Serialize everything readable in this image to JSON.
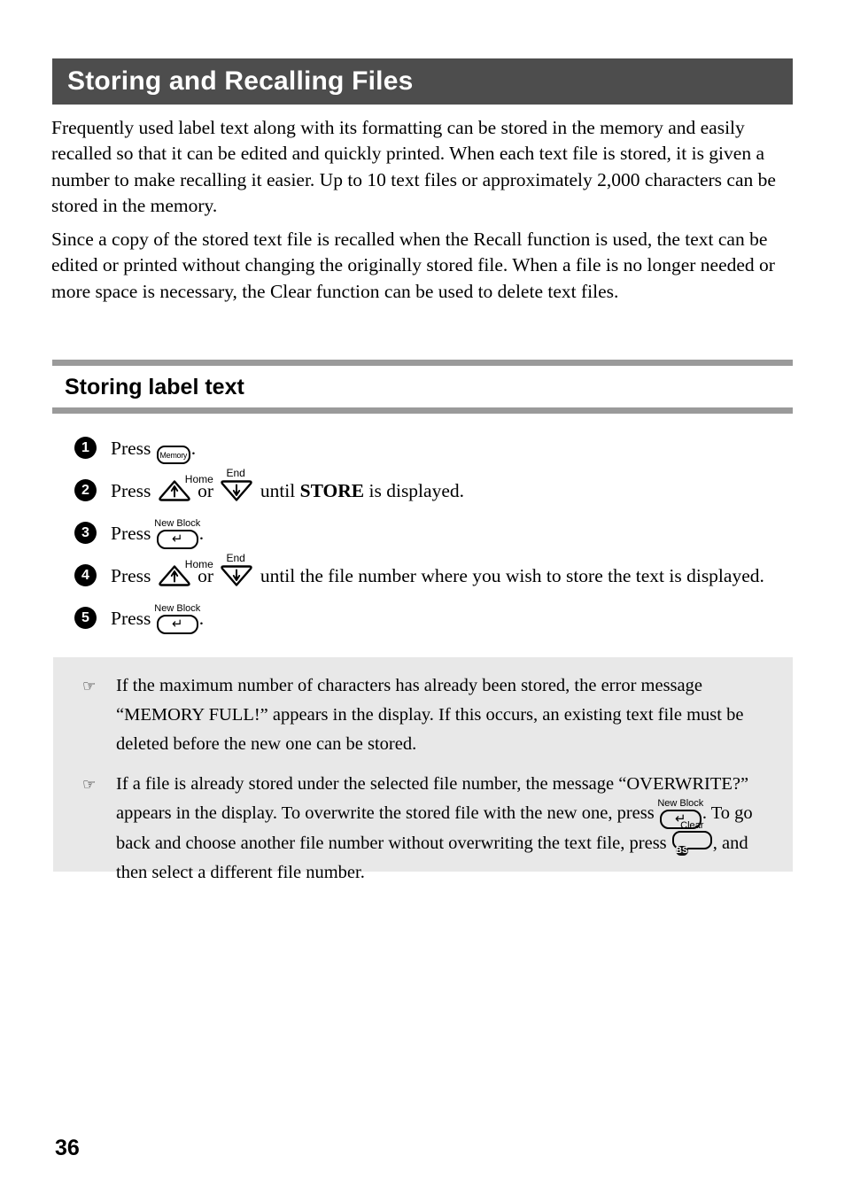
{
  "document": {
    "chapter_title": "Storing and Recalling Files",
    "page_number": "36",
    "colors": {
      "header_bar": "#4d4d4d",
      "rule": "#9a9a9a",
      "note_background": "#e8e8e8",
      "text": "#000000"
    }
  },
  "intro": {
    "paragraph_1": "Frequently used label text along with its formatting can be stored in the memory and easily recalled so that it can be edited and quickly printed. When each text file is stored, it is given a number to make recalling it easier. Up to 10 text files or approximately 2,000 characters can be stored in the memory.",
    "paragraph_2": "Since a copy of the stored text file is recalled when the Recall function is used, the text can be edited or printed without changing the originally stored file. When a file is no longer needed or more space is necessary, the Clear function can be used to delete text files."
  },
  "section": {
    "title": "Storing label text"
  },
  "steps": [
    {
      "number": "1",
      "text_before": "Press",
      "text_after": "."
    },
    {
      "number": "2",
      "text_before": "Press",
      "text_middle": "or",
      "text_after_bold": "STORE",
      "text_tail_before_bold": "until",
      "text_tail_after_bold": "is displayed."
    },
    {
      "number": "3",
      "text_before": "Press",
      "text_after": "."
    },
    {
      "number": "4",
      "text_before": "Press",
      "text_middle": "or",
      "text_after": "until the file number where you wish to store the text is displayed."
    },
    {
      "number": "5",
      "text_before": "Press",
      "text_after": "."
    }
  ],
  "keys": {
    "memory": {
      "label": "Memory",
      "cap": ""
    },
    "new_block": {
      "label": "↵",
      "cap": "New Block"
    },
    "up_arrow": {
      "label": "↑",
      "cap": "Home"
    },
    "down_arrow": {
      "label": "↓",
      "cap": "End"
    },
    "backspace": {
      "label": "BS",
      "cap": "Clear"
    }
  },
  "notes": {
    "bullet_glyph": "☞",
    "items": [
      {
        "text": "If the maximum number of characters has already been stored, the error message “MEMORY FULL!” appears in the display. If this occurs, an existing text file must be deleted before the new one can be stored."
      },
      {
        "part_1": "If a file is already stored under the selected file number, the message “OVERWRITE?” appears in the display. To overwrite the stored file with the new one, press",
        "part_2": ". To go back and choose another file number without overwriting the text file, press",
        "part_3": ", and then select a different file number."
      }
    ]
  }
}
